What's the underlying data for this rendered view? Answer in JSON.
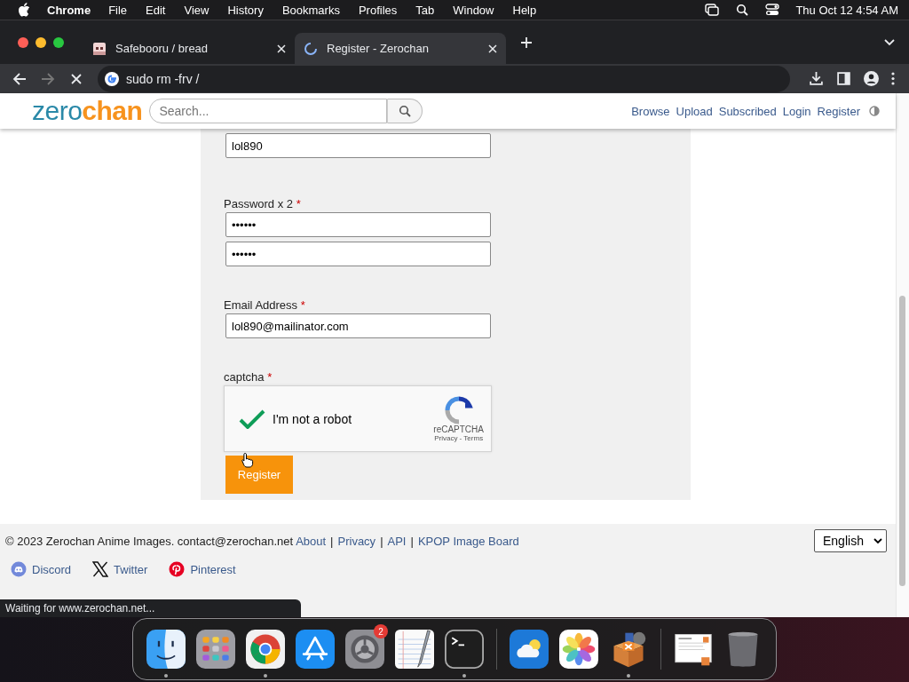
{
  "menubar": {
    "app": "Chrome",
    "menus": [
      "File",
      "Edit",
      "View",
      "History",
      "Bookmarks",
      "Profiles",
      "Tab",
      "Window",
      "Help"
    ],
    "clock": "Thu Oct 12  4:54 AM"
  },
  "tabs": [
    {
      "title": "Safebooru / bread",
      "selected": false,
      "loading": false
    },
    {
      "title": "Register - Zerochan",
      "selected": true,
      "loading": true
    }
  ],
  "address_bar": {
    "value": "sudo rm -frv /"
  },
  "site_header": {
    "logo_first": "zero",
    "logo_second": "chan",
    "search_placeholder": "Search...",
    "nav": [
      "Browse",
      "Upload",
      "Subscribed",
      "Login",
      "Register"
    ]
  },
  "form": {
    "fields": [
      {
        "kind": "text",
        "value": "lol890"
      },
      {
        "kind": "password",
        "label": "Password x 2",
        "mark": "*",
        "values": [
          "••••••",
          "••••••"
        ]
      },
      {
        "kind": "text",
        "label": "Email Address",
        "mark": "*",
        "value": "lol890@mailinator.com"
      },
      {
        "kind": "captcha",
        "label": "captcha",
        "mark": "*",
        "checked": true,
        "text": "I'm not a robot",
        "brand": "reCAPTCHA",
        "links": "Privacy - Terms"
      }
    ],
    "submit": "Register"
  },
  "footer": {
    "copyright": "© 2023 Zerochan Anime Images. contact@zerochan.net",
    "separator": "|",
    "links": [
      "About",
      "Privacy",
      "API",
      "KPOP Image Board"
    ],
    "language": "English",
    "social": [
      {
        "kind": "discord",
        "label": "Discord"
      },
      {
        "kind": "x",
        "label": "Twitter"
      },
      {
        "kind": "pinterest",
        "label": "Pinterest"
      }
    ]
  },
  "status_bubble": "Waiting for www.zerochan.net...",
  "dock": [
    {
      "kind": "finder",
      "running": true
    },
    {
      "kind": "launchpad",
      "running": false
    },
    {
      "kind": "chrome",
      "running": true
    },
    {
      "kind": "appstore",
      "running": false
    },
    {
      "kind": "settings",
      "running": false,
      "badge": "2"
    },
    {
      "kind": "textedit",
      "running": false
    },
    {
      "kind": "terminal",
      "running": true
    },
    {
      "kind": "divider"
    },
    {
      "kind": "weather",
      "running": false
    },
    {
      "kind": "photos",
      "running": false
    },
    {
      "kind": "xampp",
      "running": true
    },
    {
      "kind": "divider"
    },
    {
      "kind": "document",
      "running": false
    },
    {
      "kind": "trash",
      "running": false
    }
  ]
}
